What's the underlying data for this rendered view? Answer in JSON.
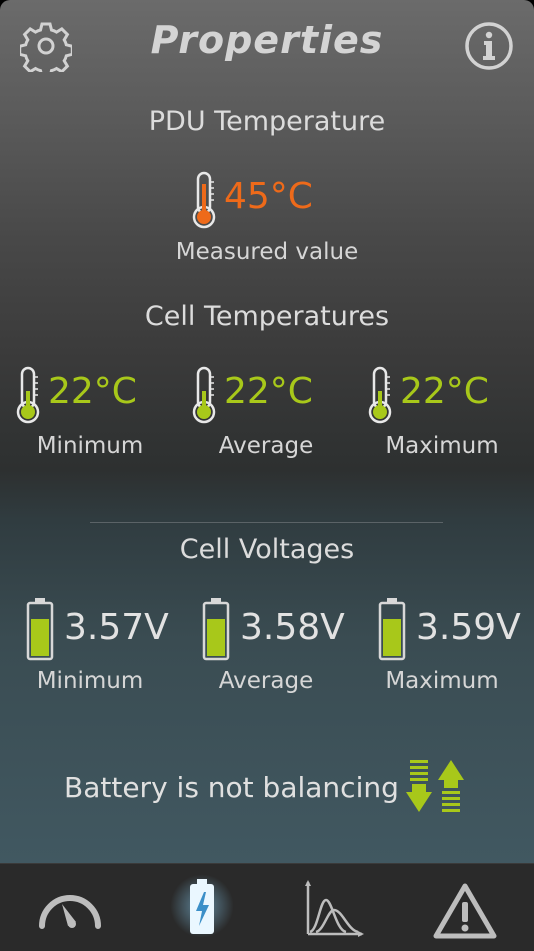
{
  "header": {
    "title": "Properties",
    "left_icon": "gear-icon",
    "right_icon": "info-icon"
  },
  "pdu": {
    "heading": "PDU Temperature",
    "value": "45°C",
    "caption": "Measured value"
  },
  "cell_temps": {
    "heading": "Cell Temperatures",
    "items": [
      {
        "value": "22°C",
        "label": "Minimum"
      },
      {
        "value": "22°C",
        "label": "Average"
      },
      {
        "value": "22°C",
        "label": "Maximum"
      }
    ]
  },
  "cell_voltages": {
    "heading": "Cell Voltages",
    "items": [
      {
        "value": "3.57V",
        "label": "Minimum"
      },
      {
        "value": "3.58V",
        "label": "Average"
      },
      {
        "value": "3.59V",
        "label": "Maximum"
      }
    ]
  },
  "balancing": {
    "status": "Battery is not balancing",
    "icon": "balancing-arrows-icon"
  },
  "tabbar": {
    "tabs": [
      {
        "icon": "gauge-icon",
        "active": false
      },
      {
        "icon": "battery-bolt-icon",
        "active": true
      },
      {
        "icon": "distribution-chart-icon",
        "active": false
      },
      {
        "icon": "warning-icon",
        "active": false
      }
    ]
  },
  "colors": {
    "accent_green": "#a8c81a",
    "warning_orange": "#ee6a1a",
    "active_glow": "#8fd8ff"
  }
}
